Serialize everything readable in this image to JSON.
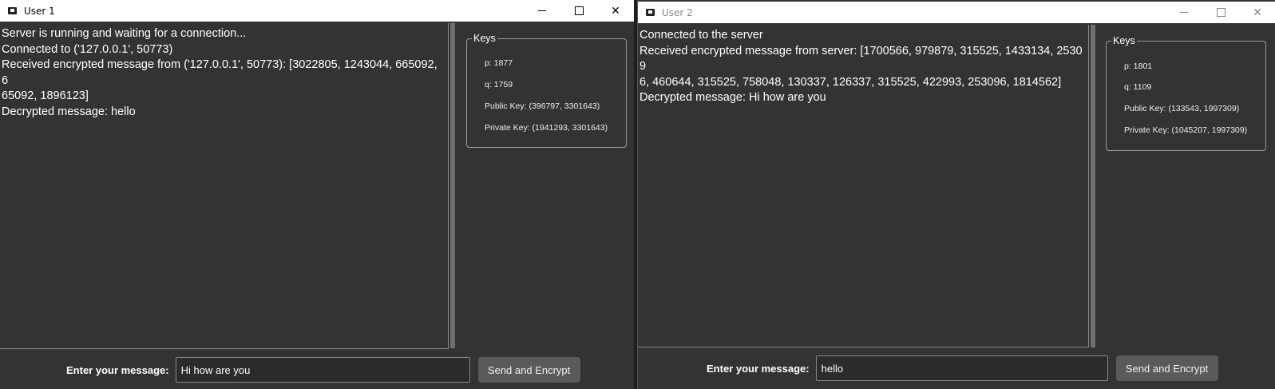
{
  "user1": {
    "title": "User 1",
    "log": "Server is running and waiting for a connection...\nConnected to ('127.0.0.1', 50773)\nReceived encrypted message from ('127.0.0.1', 50773): [3022805, 1243044, 665092, 6\n65092, 1896123]\nDecrypted message: hello",
    "keys_title": "Keys",
    "p": "p: 1877",
    "q": "q: 1759",
    "public_key": "Public Key: (396797, 3301643)",
    "private_key": "Private Key: (1941293, 3301643)",
    "msg_label": "Enter your message:",
    "msg_value": "Hi how are you",
    "send_label": "Send and Encrypt"
  },
  "user2": {
    "title": "User 2",
    "log": "Connected to the server\nReceived encrypted message from server: [1700566, 979879, 315525, 1433134, 25309\n6, 460644, 315525, 758048, 130337, 126337, 315525, 422993, 253096, 1814562]\nDecrypted message: Hi how are you",
    "keys_title": "Keys",
    "p": "p: 1801",
    "q": "q: 1109",
    "public_key": "Public Key: (133543, 1997309)",
    "private_key": "Private Key: (1045207, 1997309)",
    "msg_label": "Enter your message:",
    "msg_value": "hello",
    "send_label": "Send and Encrypt"
  },
  "icons": {
    "minimize": "minimize-icon",
    "maximize": "maximize-icon",
    "close": "close-icon",
    "app": "app-icon"
  }
}
